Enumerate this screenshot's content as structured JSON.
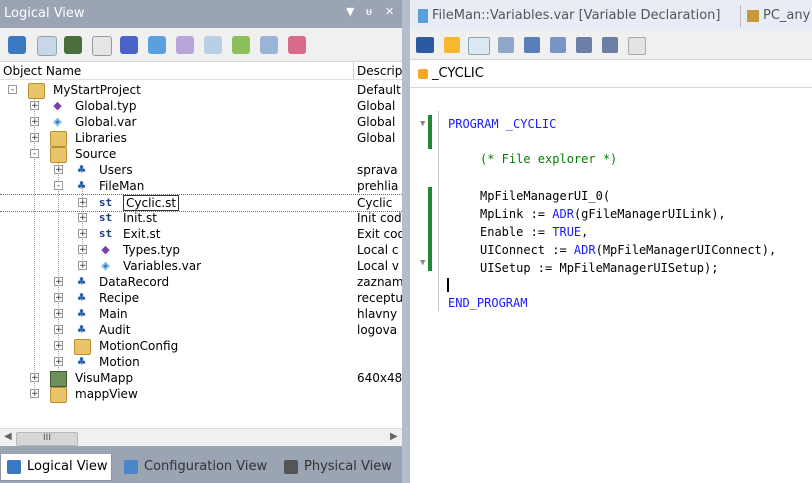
{
  "left_panel": {
    "title": "Logical View",
    "pin_label": "▾ ⊓ ✕",
    "columns": {
      "object_name": "Object Name",
      "description": "Descrip"
    },
    "tree": [
      {
        "label": "MyStartProject",
        "desc": "Default",
        "level": 0,
        "icon": "project-icon",
        "exp": "-"
      },
      {
        "label": "Global.typ",
        "desc": "Global",
        "level": 1,
        "icon": "typ-file-icon",
        "exp": "+"
      },
      {
        "label": "Global.var",
        "desc": "Global",
        "level": 1,
        "icon": "var-file-icon",
        "exp": "+"
      },
      {
        "label": "Libraries",
        "desc": "Global",
        "level": 1,
        "icon": "folder-icon",
        "exp": "+"
      },
      {
        "label": "Source",
        "desc": "",
        "level": 1,
        "icon": "folder-icon",
        "exp": "-"
      },
      {
        "label": "Users",
        "desc": "sprava",
        "level": 2,
        "icon": "package-icon",
        "exp": "+"
      },
      {
        "label": "FileMan",
        "desc": "prehlia",
        "level": 2,
        "icon": "package-icon",
        "exp": "-"
      },
      {
        "label": "Cyclic.st",
        "desc": "Cyclic",
        "level": 3,
        "icon": "st-file-icon",
        "exp": "+",
        "selected": true
      },
      {
        "label": "Init.st",
        "desc": "Init cod",
        "level": 3,
        "icon": "st-file-icon",
        "exp": "+"
      },
      {
        "label": "Exit.st",
        "desc": "Exit coo",
        "level": 3,
        "icon": "st-file-icon",
        "exp": "+"
      },
      {
        "label": "Types.typ",
        "desc": "Local c",
        "level": 3,
        "icon": "typ-file-icon",
        "exp": "+"
      },
      {
        "label": "Variables.var",
        "desc": "Local v",
        "level": 3,
        "icon": "var-file-icon",
        "exp": "+"
      },
      {
        "label": "DataRecord",
        "desc": "zaznam",
        "level": 2,
        "icon": "package-icon",
        "exp": "+"
      },
      {
        "label": "Recipe",
        "desc": "receptu",
        "level": 2,
        "icon": "package-icon",
        "exp": "+"
      },
      {
        "label": "Main",
        "desc": "hlavny",
        "level": 2,
        "icon": "package-icon",
        "exp": "+"
      },
      {
        "label": "Audit",
        "desc": "logova",
        "level": 2,
        "icon": "package-icon",
        "exp": "+"
      },
      {
        "label": "MotionConfig",
        "desc": "",
        "level": 2,
        "icon": "folder-icon",
        "exp": "+"
      },
      {
        "label": "Motion",
        "desc": "",
        "level": 2,
        "icon": "package-icon",
        "exp": "+"
      },
      {
        "label": "VisuMapp",
        "desc": "640x48",
        "level": 1,
        "icon": "visu-icon",
        "exp": "+"
      },
      {
        "label": "mappView",
        "desc": "",
        "level": 1,
        "icon": "mappview-folder-icon",
        "exp": "+"
      }
    ],
    "scroll_thumb_label": "III",
    "bottom_tabs": [
      {
        "label": "Logical View",
        "active": true
      },
      {
        "label": "Configuration View",
        "active": false
      },
      {
        "label": "Physical View",
        "active": false
      }
    ]
  },
  "editor": {
    "tabs": [
      {
        "label": "FileMan::Variables.var [Variable Declaration]"
      },
      {
        "label": "PC_any"
      }
    ],
    "program_name": "_CYCLIC",
    "code_lines": [
      {
        "kw1": "PROGRAM",
        "rest": " _CYCLIC",
        "cls": "kw"
      },
      {
        "comment": "(* File explorer *)"
      },
      {
        "text": "MpFileManagerUI_0("
      },
      {
        "text": "MpLink := ",
        "kw": "ADR",
        "text2": "(gFileManagerUILink),"
      },
      {
        "text": "Enable := ",
        "kw": "TRUE",
        "text2": ","
      },
      {
        "text": "UIConnect := ",
        "kw": "ADR",
        "text2": "(MpFileManagerUIConnect),"
      },
      {
        "text": "UISetup := MpFileManagerUISetup);"
      },
      {
        "kw1": "END_PROGRAM"
      }
    ]
  },
  "colors": {
    "accent_gutter": "#1e8a34",
    "keyword": "#1a1aff",
    "comment": "#008000"
  }
}
